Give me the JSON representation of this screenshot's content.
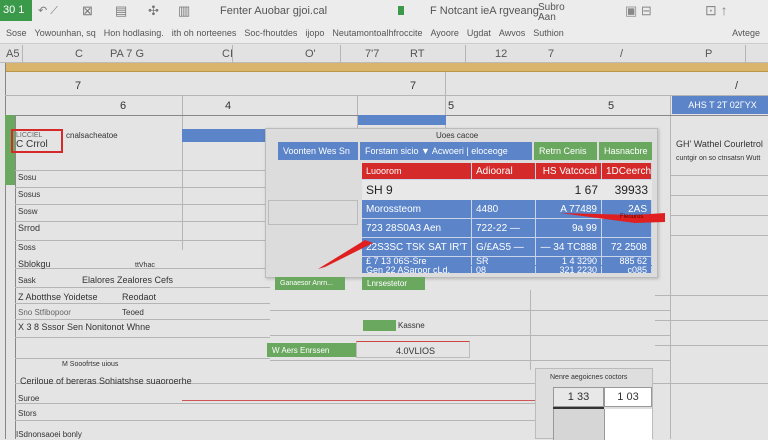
{
  "ribbon": {
    "app_badge": "30 1",
    "group1": "Fenter  Auobar  gjoi.cal",
    "group2": "F Notcant ieA rgveang",
    "group3": "Subro Aan",
    "formula_bar": [
      "Sose",
      "Yowounhan, sq",
      "Hon hodlasing.",
      "ith oh norteenes",
      "Soc-fhoutdes",
      "ijopo",
      "Neutamontoalhfroccite",
      "Ayoore",
      "Ugdat",
      "Awvos",
      "Suthion",
      "Avtege"
    ]
  },
  "column_headers": [
    "A5",
    "C",
    "PA 7 G",
    "CI",
    "O'",
    "7'7",
    "RT",
    "12",
    "7",
    "/",
    "P"
  ],
  "grid": {
    "row_labels_top": [
      "7",
      "7",
      "/"
    ],
    "row_numbers": [
      "6",
      "4",
      "5",
      "5"
    ],
    "blue_header": "AHS T 2T 02ΓΥΧ",
    "selected_cell": "C Crrol",
    "selected_cell_caption": "LICCIEL",
    "row1_text": "cnalsacheatoe",
    "left_rows": [
      "Sosu",
      "Sosus",
      "Sosw",
      "Srrod",
      "Soss"
    ],
    "row_sublok": "Sblokgu",
    "row_sublok_right": "ttVhac",
    "row_sask": "Sask",
    "row_sask_right": "Elalores Zealores Cefs",
    "row_z": "Z Abotthse Yoidetse",
    "row_z_right": "Reodaot",
    "row_sno": "Sno  Stfibopoor",
    "row_sno_right": "Teoed",
    "row_x": "X 3 8 Sssor Sen  Nonitonot Whne",
    "section_caption": "M Sooofrtse uious",
    "bottom_rows": [
      "Ceriloue of bereras Sohiatshse suaoroerhe",
      "Suroe",
      "Stors",
      "ISdnonsaoei bonly"
    ],
    "right_title": "GH' Wathel Courletrol",
    "right_sub": "cuntgir on so ctnsatsn Wutt"
  },
  "dialog": {
    "title": "Uoes cacoe",
    "tabs": [
      {
        "label": "Voonten Wes Sn",
        "color": "blue"
      },
      {
        "label": "Forstam sicio  ▼ Acwoeri | eloceoge",
        "color": "blue"
      },
      {
        "label": "Retrn Cenis",
        "color": "green"
      },
      {
        "label": "Hasnacbre",
        "color": "green"
      }
    ],
    "table": {
      "headers": [
        "Luoorom",
        "Adiooral",
        "HS Vatcocal",
        "1DCeerch"
      ],
      "summary": [
        "SH 9",
        "",
        "1 67",
        "39933"
      ],
      "rows": [
        [
          "Morossteom",
          "4480",
          "A 77489",
          "2AS"
        ],
        [
          "723  28S0A3 Aen",
          "722-22 —",
          "9a     99",
          "Fleouros"
        ],
        [
          "22S3SC TSK SAT IR'T",
          "G/£AS5 —",
          "— 34 TC888",
          "72 2508"
        ],
        [
          "£ 7 13 06S-Sre",
          "SR",
          "1 4  3290",
          "885 62"
        ],
        [
          "Gen 22 ASaroor cLd.",
          "08",
          "321  2230",
          "c085"
        ]
      ]
    },
    "buttons": [
      "Ganaesor Anrn...",
      "Lnrsestetor",
      "Kassne",
      "W Aers Enrssen",
      "4.0VLIOS"
    ]
  },
  "mini_panel": {
    "title": "Nenre aegoicnes coctors",
    "values": [
      "1 33",
      "1 03"
    ]
  },
  "colors": {
    "accent_blue": "#5b84c9",
    "accent_green": "#6aa860",
    "accent_red": "#d42a2a",
    "band": "#d8b46c"
  }
}
